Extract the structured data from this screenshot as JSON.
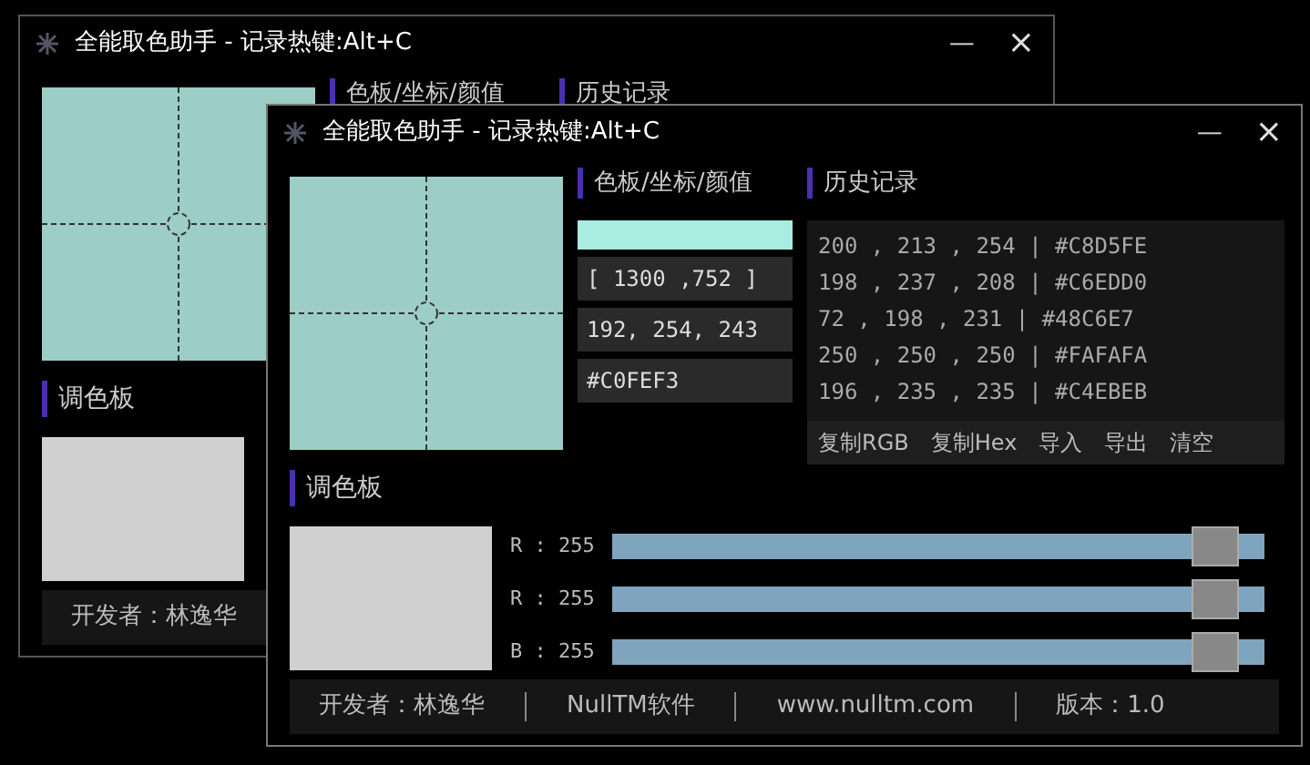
{
  "windows": [
    {
      "title": "全能取色助手 - 记录热键:Alt+C",
      "minimize": "—",
      "close": "×",
      "tabs": [
        {
          "label": "色板/坐标/颜值"
        },
        {
          "label": "历史记录"
        }
      ],
      "palette_title": "调色板",
      "footer": [
        "开发者：林逸华"
      ]
    },
    {
      "title": "全能取色助手 - 记录热键:Alt+C",
      "minimize": "—",
      "close": "×",
      "tabs": [
        {
          "label": "色板/坐标/颜值"
        },
        {
          "label": "历史记录"
        }
      ],
      "fields": [
        "[ 1300 ,752 ]",
        "192, 254, 243",
        "#C0FEF3"
      ],
      "history": [
        "200 , 213 , 254 | #C8D5FE",
        "198 , 237 , 208 | #C6EDD0",
        "72 , 198 , 231 | #48C6E7",
        "250 , 250 , 250 | #FAFAFA",
        "196 , 235 , 235 | #C4EBEB"
      ],
      "actions": [
        "复制RGB",
        "复制Hex",
        "导入",
        "导出",
        "清空"
      ],
      "palette_title": "调色板",
      "sliders": [
        {
          "label": "R : 255",
          "level": 1
        },
        {
          "label": "R : 255",
          "level": 1
        },
        {
          "label": "B : 255",
          "level": 1
        }
      ],
      "footer": [
        "开发者：林逸华",
        "NullTM软件",
        "www.nulltm.com",
        "版本：1.0"
      ]
    }
  ]
}
